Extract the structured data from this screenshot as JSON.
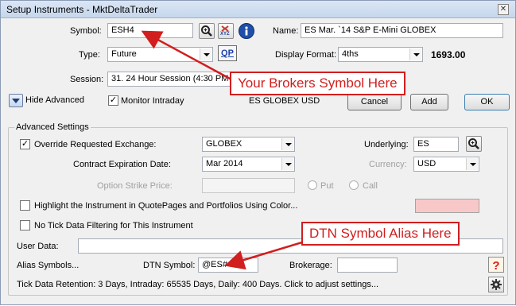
{
  "window": {
    "title": "Setup Instruments - MktDeltaTrader",
    "close_glyph": "✕"
  },
  "top": {
    "symbol_label": "Symbol:",
    "symbol_value": "ESH4",
    "name_label": "Name:",
    "name_value": "ES Mar. `14 S&P E-Mini GLOBEX",
    "type_label": "Type:",
    "type_value": "Future",
    "qp_label": "QP",
    "display_format_label": "Display Format:",
    "display_format_value": "4ths",
    "price": "1693.00",
    "session_label": "Session:",
    "session_value": "31. 24 Hour Session (4:30 PM -",
    "hide_advanced_label": "Hide Advanced",
    "monitor_intraday_label": "Monitor Intraday",
    "monitor_intraday_checked": "✓",
    "exchange_text": "ES GLOBEX USD",
    "cancel_label": "Cancel",
    "add_label": "Add",
    "ok_label": "OK",
    "xyz_label": "XYZ"
  },
  "advanced": {
    "group_title": "Advanced Settings",
    "override_label": "Override Requested Exchange:",
    "override_checked": "✓",
    "exchange_value": "GLOBEX",
    "underlying_label": "Underlying:",
    "underlying_value": "ES",
    "expiration_label": "Contract Expiration Date:",
    "expiration_value": "Mar 2014",
    "currency_label": "Currency:",
    "currency_value": "USD",
    "strike_label": "Option Strike Price:",
    "put_label": "Put",
    "call_label": "Call",
    "highlight_label": "Highlight the Instrument in QuotePages and Portfolios Using Color...",
    "highlight_color": "#f8c8c8",
    "no_tick_label": "No Tick Data Filtering for This Instrument",
    "user_data_label": "User Data:",
    "alias_symbols_label": "Alias Symbols...",
    "dtn_symbol_label": "DTN Symbol:",
    "dtn_symbol_value": "@ES#",
    "brokerage_label": "Brokerage:",
    "retention_text": "Tick Data Retention: 3 Days, Intraday: 65535 Days, Daily: 400 Days. Click to adjust settings..."
  },
  "annotations": {
    "broker_callout": "Your Brokers Symbol Here",
    "dtn_callout": "DTN Symbol Alias Here",
    "color": "#d11e1e"
  }
}
